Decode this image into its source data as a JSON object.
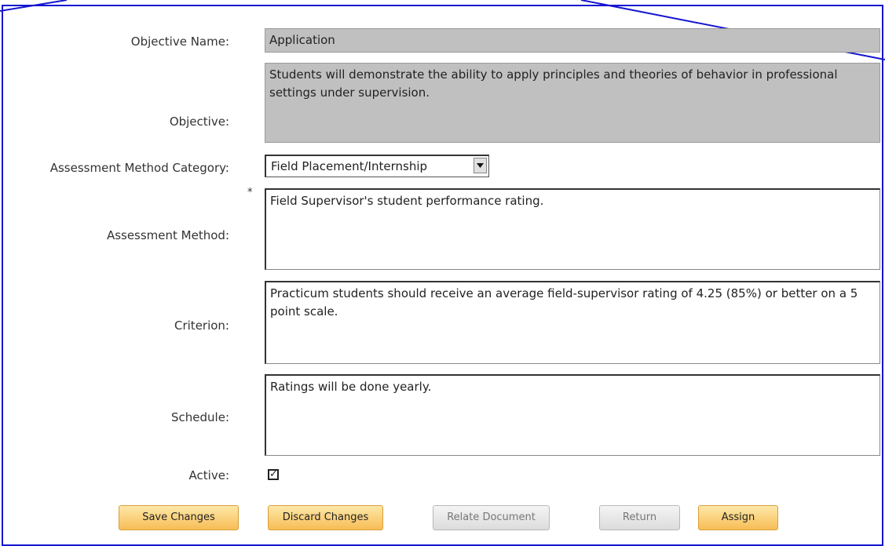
{
  "form": {
    "objective_name": {
      "label": "Objective Name:",
      "value": "Application"
    },
    "objective": {
      "label": "Objective:",
      "value": "Students will demonstrate the ability to apply principles and theories of behavior in professional settings under supervision."
    },
    "assessment_method_category": {
      "label": "Assessment Method Category:",
      "selected": "Field Placement/Internship"
    },
    "assessment_method": {
      "label": "Assessment Method:",
      "required_marker": "*",
      "value": "Field Supervisor's student performance rating."
    },
    "criterion": {
      "label": "Criterion:",
      "value": "Practicum students should receive an average field-supervisor rating of 4.25 (85%) or better on a 5 point scale."
    },
    "schedule": {
      "label": "Schedule:",
      "value": "Ratings will be done yearly."
    },
    "active": {
      "label": "Active:",
      "checked": true
    }
  },
  "buttons": {
    "save": "Save Changes",
    "discard": "Discard Changes",
    "relate": "Relate Document",
    "return": "Return",
    "assign": "Assign"
  },
  "colors": {
    "frame_border": "#1515d0",
    "button_primary": "#f8bd55",
    "readonly_field": "#c0c0c0"
  }
}
